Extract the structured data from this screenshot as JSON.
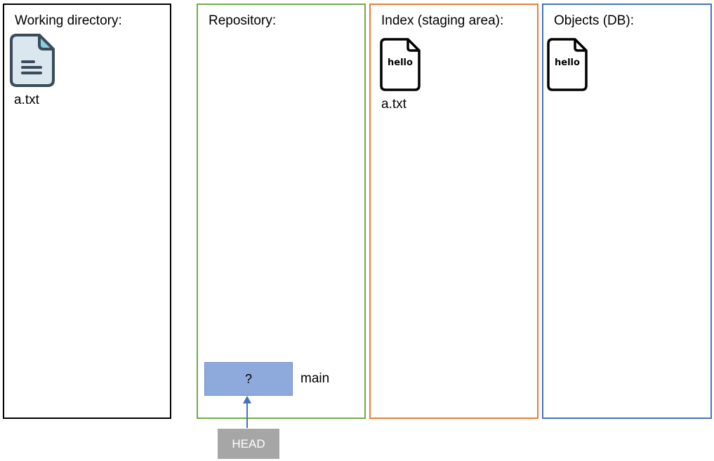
{
  "panels": {
    "working_directory": {
      "title": "Working directory:",
      "file": {
        "name": "a.txt",
        "icon": "document-icon"
      }
    },
    "repository": {
      "title": "Repository:"
    },
    "index": {
      "title": "Index (staging area):",
      "file": {
        "name": "a.txt",
        "icon": "file-hello-icon",
        "content": "hello"
      }
    },
    "objects": {
      "title": "Objects (DB):",
      "blob": {
        "icon": "file-hello-icon",
        "content": "hello"
      }
    }
  },
  "commit": {
    "label": "?",
    "branch": "main"
  },
  "head": {
    "label": "HEAD"
  },
  "colors": {
    "working_directory_border": "#000000",
    "repository_border": "#70ad47",
    "index_border": "#ed7d31",
    "objects_border": "#4472c4",
    "commit_fill": "#8ea9db",
    "head_fill": "#a6a6a6",
    "arrow": "#4472c4"
  }
}
